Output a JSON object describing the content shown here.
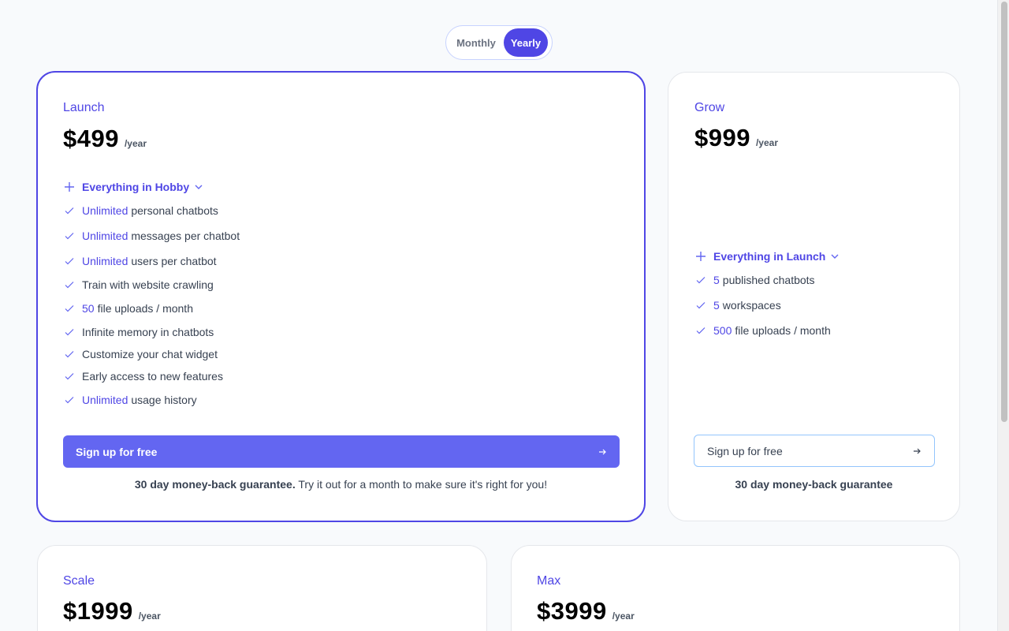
{
  "billing_toggle": {
    "monthly_label": "Monthly",
    "yearly_label": "Yearly",
    "selected": "Yearly"
  },
  "colors": {
    "accent": "#4f46e5",
    "button": "#6366f1",
    "background": "#f8fafc"
  },
  "plans": [
    {
      "name": "Launch",
      "price": "$499",
      "period": "/year",
      "everything_label": "Everything in Hobby",
      "features": [
        {
          "highlight": "Unlimited",
          "text": "personal chatbots"
        },
        {
          "highlight": "Unlimited",
          "text": "messages per chatbot"
        },
        {
          "highlight": "Unlimited",
          "text": "users per chatbot"
        },
        {
          "highlight": "",
          "text": "Train with website crawling"
        },
        {
          "highlight": "50",
          "text": "file uploads / month"
        },
        {
          "highlight": "",
          "text": "Infinite memory in chatbots"
        },
        {
          "highlight": "",
          "text": "Customize your chat widget"
        },
        {
          "highlight": "",
          "text": "Early access to new features"
        },
        {
          "highlight": "Unlimited",
          "text": "usage history"
        }
      ],
      "cta": "Sign up for free",
      "guarantee_bold": "30 day money-back guarantee.",
      "guarantee_rest": "Try it out for a month to make sure it's right for you!"
    },
    {
      "name": "Grow",
      "price": "$999",
      "period": "/year",
      "everything_label": "Everything in Launch",
      "features": [
        {
          "highlight": "5",
          "text": "published chatbots"
        },
        {
          "highlight": "5",
          "text": "workspaces"
        },
        {
          "highlight": "500",
          "text": "file uploads / month"
        }
      ],
      "cta": "Sign up for free",
      "guarantee_bold": "30 day money-back guarantee"
    },
    {
      "name": "Scale",
      "price": "$1999",
      "period": "/year"
    },
    {
      "name": "Max",
      "price": "$3999",
      "period": "/year"
    }
  ]
}
